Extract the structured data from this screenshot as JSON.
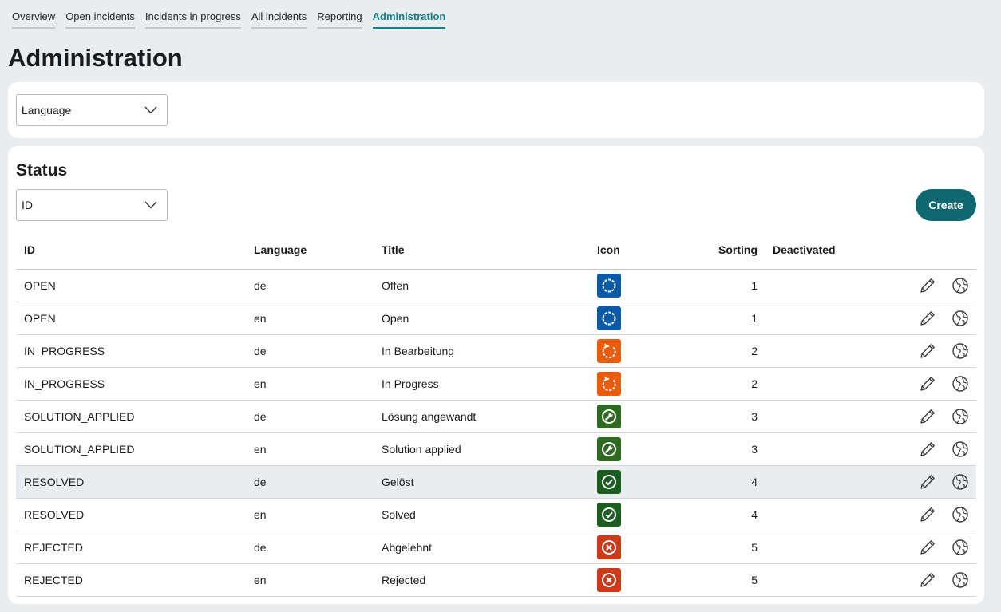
{
  "tabs": [
    {
      "label": "Overview",
      "active": false
    },
    {
      "label": "Open incidents",
      "active": false
    },
    {
      "label": "Incidents in progress",
      "active": false
    },
    {
      "label": "All incidents",
      "active": false
    },
    {
      "label": "Reporting",
      "active": false
    },
    {
      "label": "Administration",
      "active": true
    }
  ],
  "page_title": "Administration",
  "language_select": {
    "value": "Language"
  },
  "status_section": {
    "title": "Status",
    "filter_select": {
      "value": "ID"
    },
    "create_label": "Create"
  },
  "table": {
    "columns": {
      "id": "ID",
      "language": "Language",
      "title": "Title",
      "icon": "Icon",
      "sorting": "Sorting",
      "deactivated": "Deactivated"
    },
    "rows": [
      {
        "id": "OPEN",
        "language": "de",
        "title": "Offen",
        "icon": "open-status-icon",
        "icon_color": "#0b5aa7",
        "sorting": "1"
      },
      {
        "id": "OPEN",
        "language": "en",
        "title": "Open",
        "icon": "open-status-icon",
        "icon_color": "#0b5aa7",
        "sorting": "1"
      },
      {
        "id": "IN_PROGRESS",
        "language": "de",
        "title": "In Bearbeitung",
        "icon": "in-progress-status-icon",
        "icon_color": "#ea5b0c",
        "sorting": "2"
      },
      {
        "id": "IN_PROGRESS",
        "language": "en",
        "title": "In Progress",
        "icon": "in-progress-status-icon",
        "icon_color": "#ea5b0c",
        "sorting": "2"
      },
      {
        "id": "SOLUTION_APPLIED",
        "language": "de",
        "title": "Lösung angewandt",
        "icon": "wrench-status-icon",
        "icon_color": "#2f6a22",
        "sorting": "3"
      },
      {
        "id": "SOLUTION_APPLIED",
        "language": "en",
        "title": "Solution applied",
        "icon": "wrench-status-icon",
        "icon_color": "#2f6a22",
        "sorting": "3"
      },
      {
        "id": "RESOLVED",
        "language": "de",
        "title": "Gelöst",
        "icon": "check-status-icon",
        "icon_color": "#1b5e20",
        "sorting": "4"
      },
      {
        "id": "RESOLVED",
        "language": "en",
        "title": "Solved",
        "icon": "check-status-icon",
        "icon_color": "#1b5e20",
        "sorting": "4"
      },
      {
        "id": "REJECTED",
        "language": "de",
        "title": "Abgelehnt",
        "icon": "cross-status-icon",
        "icon_color": "#cc3a1a",
        "sorting": "5"
      },
      {
        "id": "REJECTED",
        "language": "en",
        "title": "Rejected",
        "icon": "cross-status-icon",
        "icon_color": "#cc3a1a",
        "sorting": "5"
      }
    ]
  },
  "row_actions": [
    "pencil-icon",
    "globe-icon"
  ],
  "colors": {
    "accent": "#16818a",
    "button": "#0f6770",
    "background": "#e9edf0"
  }
}
